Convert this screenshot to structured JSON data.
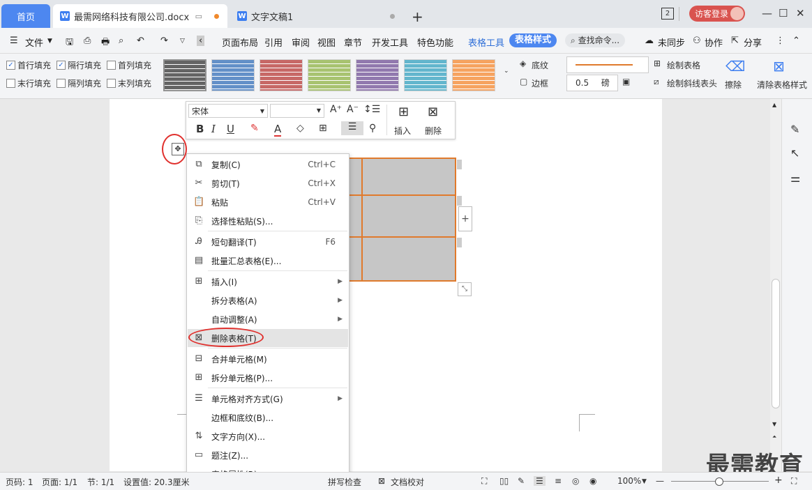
{
  "tabs": {
    "home": "首页",
    "doc1": "最需网络科技有限公司.docx",
    "doc2": "文字文稿1",
    "login": "访客登录",
    "badge": "2"
  },
  "menubar": {
    "file": "文件",
    "items": [
      "页面布局",
      "引用",
      "审阅",
      "视图",
      "章节",
      "开发工具",
      "特色功能"
    ],
    "table_tools": "表格工具",
    "table_style": "表格样式",
    "search": "查找命令...",
    "unsync": "未同步",
    "collab": "协作",
    "share": "分享"
  },
  "ribbon": {
    "checks": [
      {
        "label": "首行填充",
        "checked": true
      },
      {
        "label": "隔行填充",
        "checked": true
      },
      {
        "label": "首列填充",
        "checked": false
      },
      {
        "label": "末行填充",
        "checked": false
      },
      {
        "label": "隔列填充",
        "checked": false
      },
      {
        "label": "末列填充",
        "checked": false
      }
    ],
    "swatch_colors": [
      "#555555",
      "#4a7fc1",
      "#c0504d",
      "#9bbb59",
      "#8064a2",
      "#4bacc6",
      "#f79646"
    ],
    "shading": "底纹",
    "border": "边框",
    "line_width": "0.5",
    "unit": "磅",
    "draw_table": "绘制表格",
    "draw_diag": "绘制斜线表头",
    "erase": "擦除",
    "clear_style": "清除表格样式"
  },
  "minitoolbar": {
    "font": "宋体",
    "insert": "插入",
    "delete": "删除"
  },
  "context_menu": [
    {
      "label": "复制(C)",
      "shortcut": "Ctrl+C",
      "icon": "copy-icon",
      "glyph": "⧉"
    },
    {
      "label": "剪切(T)",
      "shortcut": "Ctrl+X",
      "icon": "scissors-icon",
      "glyph": "✂"
    },
    {
      "label": "粘贴",
      "shortcut": "Ctrl+V",
      "icon": "paste-icon",
      "glyph": "📋"
    },
    {
      "label": "选择性粘贴(S)...",
      "shortcut": "",
      "icon": "paste-special-icon",
      "glyph": "⎘"
    },
    {
      "label": "短句翻译(T)",
      "shortcut": "F6",
      "icon": "translate-icon",
      "glyph": "Ꭿ"
    },
    {
      "label": "批量汇总表格(E)...",
      "shortcut": "",
      "icon": "batch-table-icon",
      "glyph": "▤"
    },
    {
      "label": "插入(I)",
      "shortcut": "",
      "icon": "insert-table-icon",
      "glyph": "⊞",
      "sub": true
    },
    {
      "label": "拆分表格(A)",
      "shortcut": "",
      "icon": "",
      "glyph": "",
      "sub": true
    },
    {
      "label": "自动调整(A)",
      "shortcut": "",
      "icon": "",
      "glyph": "",
      "sub": true
    },
    {
      "label": "删除表格(T)",
      "shortcut": "",
      "icon": "delete-table-icon",
      "glyph": "⊠",
      "highlight": true
    },
    {
      "label": "合并单元格(M)",
      "shortcut": "",
      "icon": "merge-cells-icon",
      "glyph": "⊟"
    },
    {
      "label": "拆分单元格(P)...",
      "shortcut": "",
      "icon": "split-cells-icon",
      "glyph": "⊞"
    },
    {
      "label": "单元格对齐方式(G)",
      "shortcut": "",
      "icon": "cell-align-icon",
      "glyph": "☰",
      "sub": true
    },
    {
      "label": "边框和底纹(B)...",
      "shortcut": "",
      "icon": "",
      "glyph": ""
    },
    {
      "label": "文字方向(X)...",
      "shortcut": "",
      "icon": "text-direction-icon",
      "glyph": "⇅"
    },
    {
      "label": "题注(Z)...",
      "shortcut": "",
      "icon": "caption-icon",
      "glyph": "▭"
    },
    {
      "label": "表格属性(R)...",
      "shortcut": "",
      "icon": "",
      "glyph": ""
    }
  ],
  "status": {
    "page_code": "页码: 1",
    "pages": "页面: 1/1",
    "section": "节: 1/1",
    "setting": "设置值: 20.3厘米",
    "check": "拼写检查",
    "proof": "文档校对",
    "zoom": "100%"
  },
  "watermark": "最需教育"
}
